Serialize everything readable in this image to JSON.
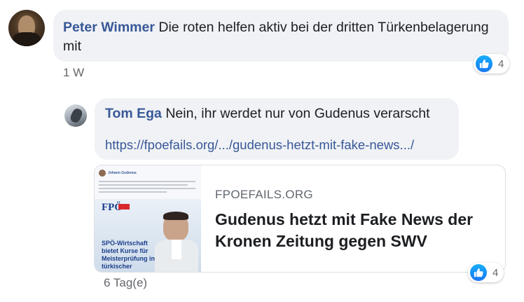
{
  "comments": [
    {
      "author": "Peter Wimmer",
      "text": "Die roten helfen aktiv bei der dritten Türkenbelagerung mit",
      "timestamp": "1 W",
      "reaction_count": "4"
    },
    {
      "author": "Tom Ega",
      "text": "Nein, ihr werdet nur von Gudenus verarscht",
      "link": "https://fpoefails.org/.../gudenus-hetzt-mit-fake-news.../",
      "timestamp": "6 Tag(e)",
      "reaction_count": "4",
      "preview": {
        "domain": "FPOEFAILS.ORG",
        "title": "Gudenus hetzt mit Fake News der Kronen Zeitung gegen SWV",
        "thumb": {
          "poster_name": "Johann Gudenus",
          "badge": "FPÖ",
          "headline": "SPÖ-Wirtschaft bietet Kurse für Meisterprüfung in türkischer"
        }
      }
    }
  ],
  "colors": {
    "bubble_bg": "#f0f2f5",
    "name": "#385898",
    "meta": "#65676b",
    "like": "#1877f2"
  },
  "icons": {
    "like": "thumbs-up-icon"
  }
}
